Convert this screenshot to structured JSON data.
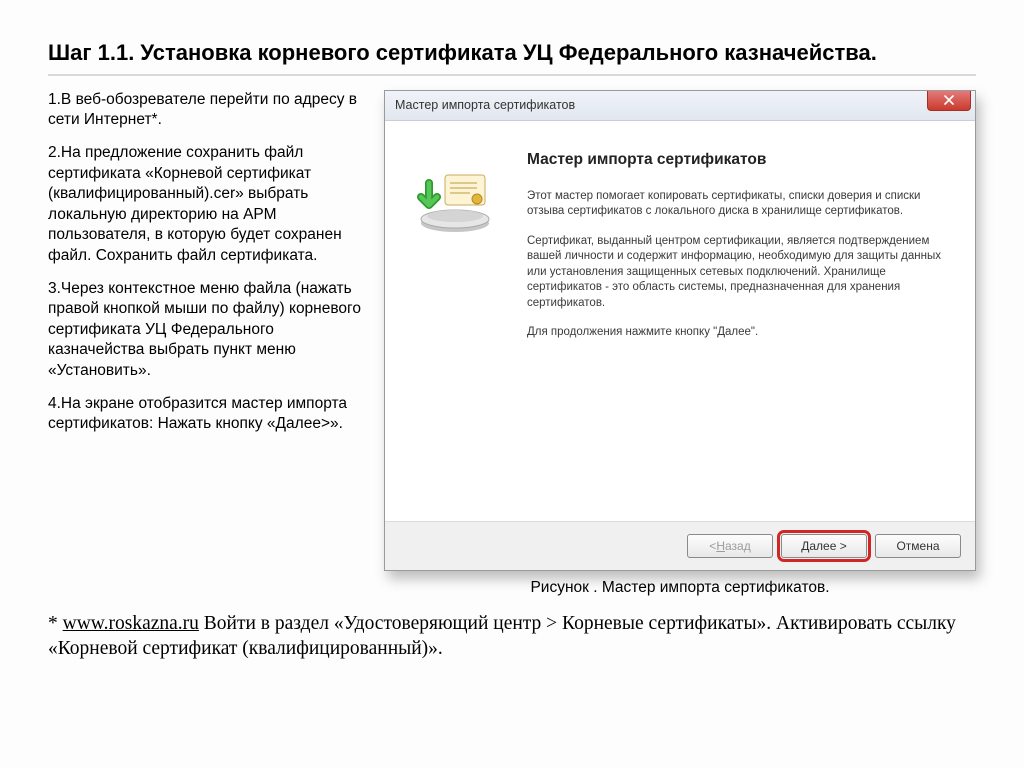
{
  "title": "Шаг 1.1. Установка корневого сертификата УЦ Федерального казначейства.",
  "para1": "1.В веб-обозревателе перейти по адресу в сети Интернет*.",
  "para2": "2.На предложение сохранить файл сертификата «Корневой сертификат (квалифицированный).cer» выбрать локальную директорию на АРМ пользователя, в которую будет сохранен файл. Сохранить файл сертификата.",
  "para3": "3.Через контекстное меню файла (нажать правой кнопкой мыши по файлу) корневого сертификата УЦ Федерального казначейства выбрать пункт меню «Установить».",
  "para4": "4.На экране отобразится мастер импорта сертификатов: Нажать кнопку «Далее>».",
  "caption": "Рисунок . Мастер импорта сертификатов.",
  "footnote_pre": "* ",
  "footnote_link": "www.roskazna.ru",
  "footnote_post": "  Войти в раздел «Удостоверяющий центр > Корневые сертификаты». Активировать ссылку «Корневой сертификат (квалифицированный)».",
  "wizard": {
    "titlebar": "Мастер импорта сертификатов",
    "heading": "Мастер импорта сертификатов",
    "body1": "Этот мастер помогает копировать сертификаты, списки доверия и списки отзыва сертификатов с локального диска в хранилище сертификатов.",
    "body2": "Сертификат, выданный центром сертификации, является подтверждением вашей личности и содержит информацию, необходимую для защиты данных или установления защищенных сетевых подключений. Хранилище сертификатов - это область системы, предназначенная для хранения сертификатов.",
    "body3": "Для продолжения нажмите кнопку \"Далее\".",
    "buttons": {
      "back_pre": "< ",
      "back_u": "Н",
      "back_post": "азад",
      "next_pre": "",
      "next_u": "Д",
      "next_post": "алее >",
      "cancel": "Отмена"
    }
  }
}
